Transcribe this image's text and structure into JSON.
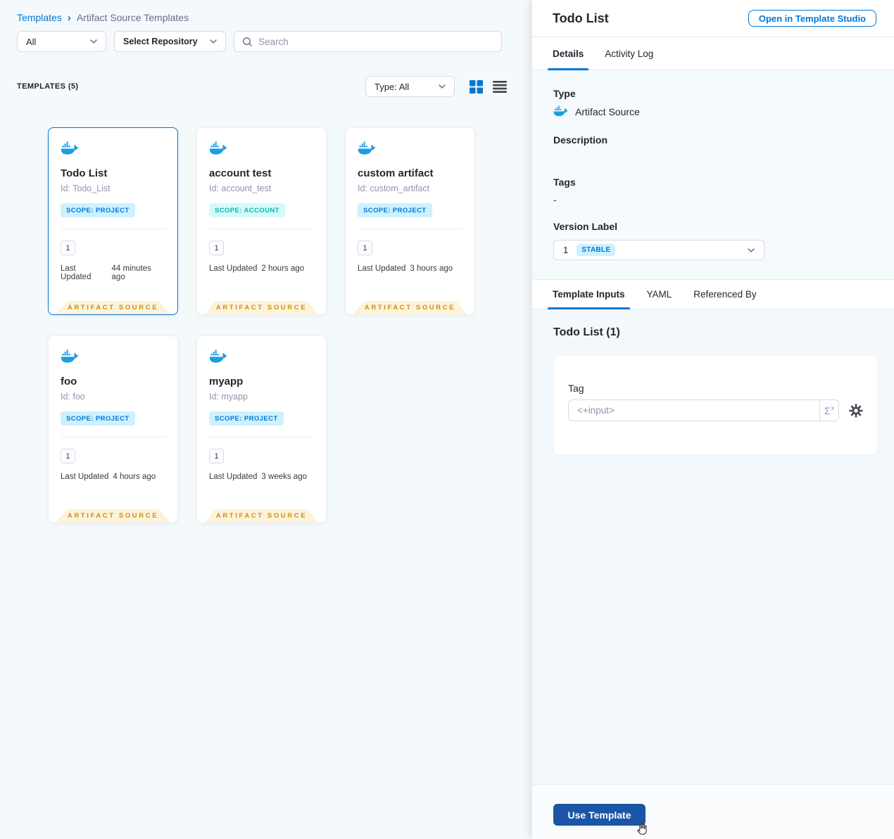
{
  "colors": {
    "primary_blue": "#0278d5",
    "docker_blue": "#1b9de2",
    "scope_project_text": "#0278d5",
    "scope_project_bg": "#cdf1fe",
    "scope_account_text": "#0ab5ac",
    "scope_account_bg": "#d3fcf9",
    "ribbon_text": "#d28e0c",
    "ribbon_bg": "#fcf3da",
    "use_template_bg": "#1b55a5"
  },
  "breadcrumb": {
    "parent": "Templates",
    "separator": "›",
    "current": "Artifact Source Templates"
  },
  "filters": {
    "scope_dropdown": "All",
    "repository_dropdown": "Select Repository",
    "search_placeholder": "Search"
  },
  "list_header": {
    "count_label": "TEMPLATES (5)",
    "type_filter": "Type: All"
  },
  "card_labels": {
    "last_updated": "Last Updated",
    "ribbon": "ARTIFACT SOURCE"
  },
  "cards": [
    {
      "title": "Todo List",
      "id_label": "Id: Todo_List",
      "scope": "SCOPE: PROJECT",
      "version": "1",
      "updated": "44 minutes ago"
    },
    {
      "title": "account test",
      "id_label": "Id: account_test",
      "scope": "SCOPE: ACCOUNT",
      "version": "1",
      "updated": "2 hours ago"
    },
    {
      "title": "custom artifact",
      "id_label": "Id: custom_artifact",
      "scope": "SCOPE: PROJECT",
      "version": "1",
      "updated": "3 hours ago"
    },
    {
      "title": "foo",
      "id_label": "Id: foo",
      "scope": "SCOPE: PROJECT",
      "version": "1",
      "updated": "4 hours ago"
    },
    {
      "title": "myapp",
      "id_label": "Id: myapp",
      "scope": "SCOPE: PROJECT",
      "version": "1",
      "updated": "3 weeks ago"
    }
  ],
  "panel": {
    "title": "Todo List",
    "open_studio_button": "Open in Template Studio",
    "tabs": {
      "details": "Details",
      "activity_log": "Activity Log"
    },
    "details": {
      "type_label": "Type",
      "type_value": "Artifact Source",
      "description_label": "Description",
      "tags_label": "Tags",
      "tags_value": "-",
      "version_label": "Version Label",
      "version_value": "1",
      "version_badge": "STABLE"
    },
    "inner_tabs": {
      "template_inputs": "Template Inputs",
      "yaml": "YAML",
      "referenced_by": "Referenced By"
    },
    "inputs": {
      "heading": "Todo List (1)",
      "tag_label": "Tag",
      "tag_value": "<+input>",
      "expression_icon": "Σ",
      "expression_sub": "x"
    },
    "footer": {
      "use_template_button": "Use Template"
    }
  }
}
